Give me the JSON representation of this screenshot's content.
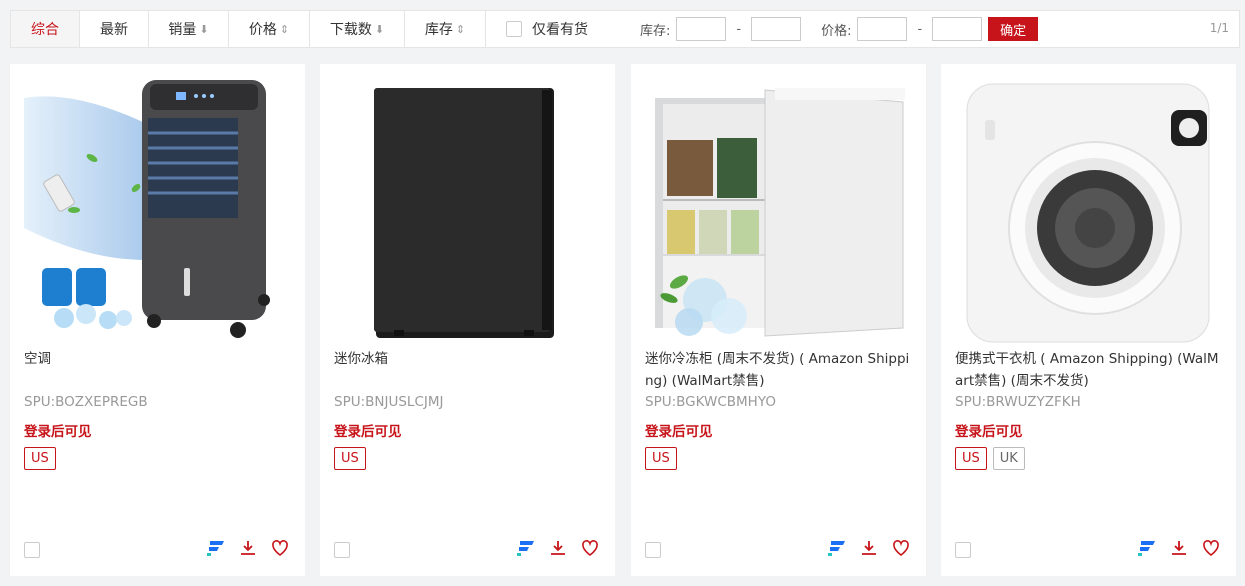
{
  "toolbar": {
    "tabs": [
      {
        "label": "综合",
        "arrow": ""
      },
      {
        "label": "最新",
        "arrow": ""
      },
      {
        "label": "销量",
        "arrow": "⬇"
      },
      {
        "label": "价格",
        "arrow": "⇕"
      },
      {
        "label": "下载数",
        "arrow": "⬇"
      },
      {
        "label": "库存",
        "arrow": "⇕"
      }
    ],
    "in_stock_label": "仅看有货",
    "stock_label": "库存:",
    "price_label": "价格:",
    "dash": "-",
    "confirm_label": "确定",
    "pager": "1/1"
  },
  "products": [
    {
      "name": "空调",
      "spu": "SPU:BOZXEPREGB",
      "login_note": "登录后可见",
      "regions": [
        "US"
      ],
      "image": "air-cooler"
    },
    {
      "name": "迷你冰箱",
      "spu": "SPU:BNJUSLCJMJ",
      "login_note": "登录后可见",
      "regions": [
        "US"
      ],
      "image": "mini-fridge"
    },
    {
      "name": "迷你冷冻柜 (周末不发货) ( Amazon Shipping) (WalMart禁售)",
      "spu": "SPU:BGKWCBMHYO",
      "login_note": "登录后可见",
      "regions": [
        "US"
      ],
      "image": "mini-freezer"
    },
    {
      "name": "便携式干衣机 ( Amazon Shipping) (WalMart禁售) (周末不发货)",
      "spu": "SPU:BRWUZYZFKH",
      "login_note": "登录后可见",
      "regions": [
        "US",
        "UK"
      ],
      "image": "clothes-dryer"
    }
  ],
  "colors": {
    "accent": "#c7141a",
    "brand_blue": "#1a6ff2"
  }
}
